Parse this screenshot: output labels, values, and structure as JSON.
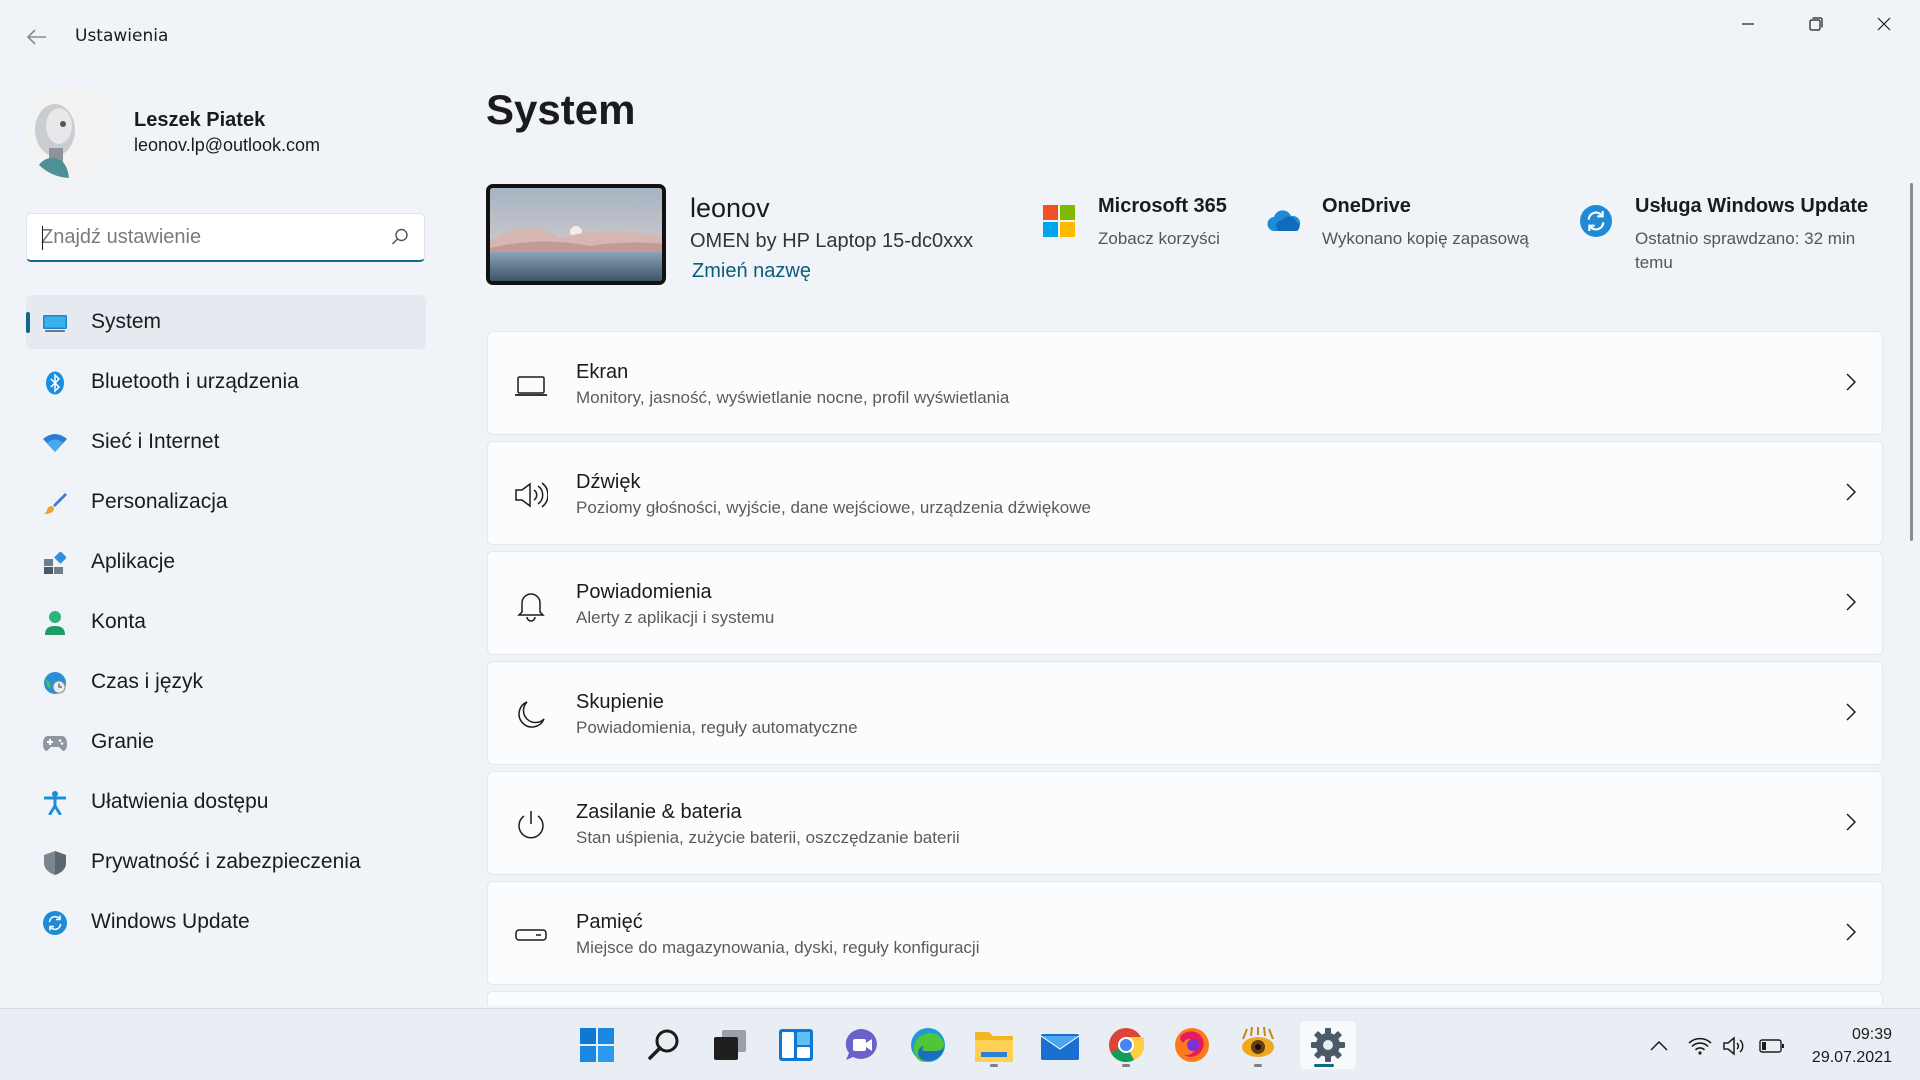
{
  "window": {
    "title": "Ustawienia",
    "back_icon": "back-arrow-icon",
    "controls": [
      "minimize-icon",
      "restore-icon",
      "close-icon"
    ]
  },
  "profile": {
    "name": "Leszek Piatek",
    "email": "leonov.lp@outlook.com"
  },
  "search": {
    "placeholder": "Znajdź ustawienie",
    "value": ""
  },
  "sidebar": {
    "items": [
      {
        "label": "System",
        "icon": "display-icon",
        "active": true
      },
      {
        "label": "Bluetooth i urządzenia",
        "icon": "bluetooth-icon"
      },
      {
        "label": "Sieć i Internet",
        "icon": "wifi-icon"
      },
      {
        "label": "Personalizacja",
        "icon": "brush-icon"
      },
      {
        "label": "Aplikacje",
        "icon": "apps-icon"
      },
      {
        "label": "Konta",
        "icon": "person-icon"
      },
      {
        "label": "Czas i język",
        "icon": "globe-clock-icon"
      },
      {
        "label": "Granie",
        "icon": "gamepad-icon"
      },
      {
        "label": "Ułatwienia dostępu",
        "icon": "accessibility-icon"
      },
      {
        "label": "Prywatność i zabezpieczenia",
        "icon": "shield-icon"
      },
      {
        "label": "Windows Update",
        "icon": "update-icon"
      }
    ]
  },
  "main": {
    "title": "System",
    "device": {
      "name": "leonov",
      "model": "OMEN by HP Laptop 15-dc0xxx",
      "rename_label": "Zmień nazwę"
    },
    "quick_status": [
      {
        "title": "Microsoft 365",
        "subtitle": "Zobacz korzyści",
        "icon": "microsoft-logo-icon"
      },
      {
        "title": "OneDrive",
        "subtitle": "Wykonano kopię zapasową",
        "icon": "onedrive-cloud-icon"
      },
      {
        "title": "Usługa Windows Update",
        "subtitle": "Ostatnio sprawdzano: 32 min temu",
        "icon": "windows-update-icon"
      }
    ],
    "cards": [
      {
        "title": "Ekran",
        "description": "Monitory, jasność, wyświetlanie nocne, profil wyświetlania",
        "icon": "laptop-icon"
      },
      {
        "title": "Dźwięk",
        "description": "Poziomy głośności, wyjście, dane wejściowe, urządzenia dźwiękowe",
        "icon": "speaker-icon"
      },
      {
        "title": "Powiadomienia",
        "description": "Alerty z aplikacji i systemu",
        "icon": "bell-icon"
      },
      {
        "title": "Skupienie",
        "description": "Powiadomienia, reguły automatyczne",
        "icon": "moon-icon"
      },
      {
        "title": "Zasilanie & bateria",
        "description": "Stan uśpienia, zużycie baterii, oszczędzanie baterii",
        "icon": "power-icon"
      },
      {
        "title": "Pamięć",
        "description": "Miejsce do magazynowania, dyski, reguły konfiguracji",
        "icon": "storage-drive-icon"
      }
    ]
  },
  "taskbar": {
    "apps": [
      "start-icon",
      "search-icon",
      "task-view-icon",
      "widgets-icon",
      "chat-icon",
      "edge-icon",
      "file-explorer-icon",
      "mail-icon",
      "chrome-icon",
      "firefox-icon",
      "xnview-icon",
      "settings-gear-icon"
    ],
    "tray": [
      "chevron-up-icon",
      "wifi-icon",
      "volume-icon",
      "battery-icon"
    ],
    "time": "09:39",
    "date": "29.07.2021"
  },
  "colors": {
    "accent": "#0f6a8a",
    "background": "#f0f4f9",
    "card": "#fbfcfd"
  }
}
